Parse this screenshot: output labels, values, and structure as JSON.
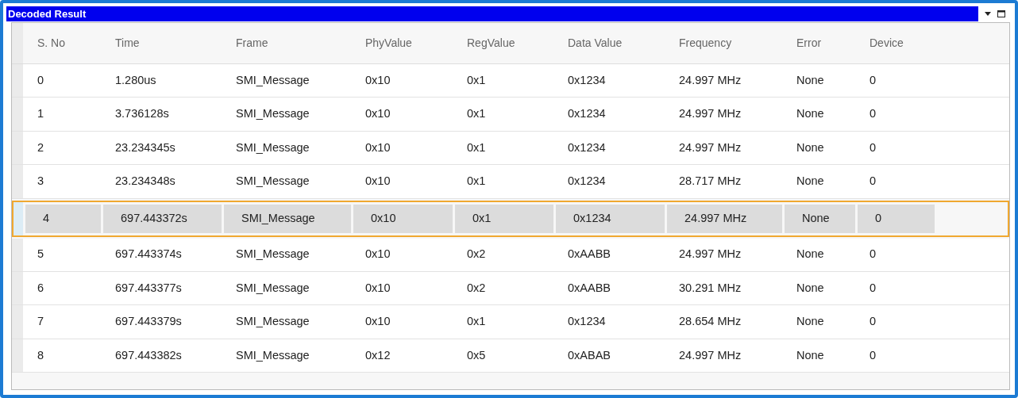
{
  "window": {
    "title": "Decoded Result"
  },
  "table": {
    "columns": [
      "S. No",
      "Time",
      "Frame",
      "PhyValue",
      "RegValue",
      "Data Value",
      "Frequency",
      "Error",
      "Device"
    ],
    "rows": [
      {
        "selected": false,
        "cells": [
          "0",
          "1.280us",
          "SMI_Message",
          "0x10",
          "0x1",
          "0x1234",
          "24.997 MHz",
          "None",
          "0"
        ]
      },
      {
        "selected": false,
        "cells": [
          "1",
          "3.736128s",
          "SMI_Message",
          "0x10",
          "0x1",
          "0x1234",
          "24.997 MHz",
          "None",
          "0"
        ]
      },
      {
        "selected": false,
        "cells": [
          "2",
          "23.234345s",
          "SMI_Message",
          "0x10",
          "0x1",
          "0x1234",
          "24.997 MHz",
          "None",
          "0"
        ]
      },
      {
        "selected": false,
        "cells": [
          "3",
          "23.234348s",
          "SMI_Message",
          "0x10",
          "0x1",
          "0x1234",
          "28.717 MHz",
          "None",
          "0"
        ]
      },
      {
        "selected": true,
        "cells": [
          "4",
          "697.443372s",
          "SMI_Message",
          "0x10",
          "0x1",
          "0x1234",
          "24.997 MHz",
          "None",
          "0"
        ]
      },
      {
        "selected": false,
        "cells": [
          "5",
          "697.443374s",
          "SMI_Message",
          "0x10",
          "0x2",
          "0xAABB",
          "24.997 MHz",
          "None",
          "0"
        ]
      },
      {
        "selected": false,
        "cells": [
          "6",
          "697.443377s",
          "SMI_Message",
          "0x10",
          "0x2",
          "0xAABB",
          "30.291 MHz",
          "None",
          "0"
        ]
      },
      {
        "selected": false,
        "cells": [
          "7",
          "697.443379s",
          "SMI_Message",
          "0x10",
          "0x1",
          "0x1234",
          "28.654 MHz",
          "None",
          "0"
        ]
      },
      {
        "selected": false,
        "cells": [
          "8",
          "697.443382s",
          "SMI_Message",
          "0x12",
          "0x5",
          "0xABAB",
          "24.997 MHz",
          "None",
          "0"
        ]
      }
    ]
  }
}
